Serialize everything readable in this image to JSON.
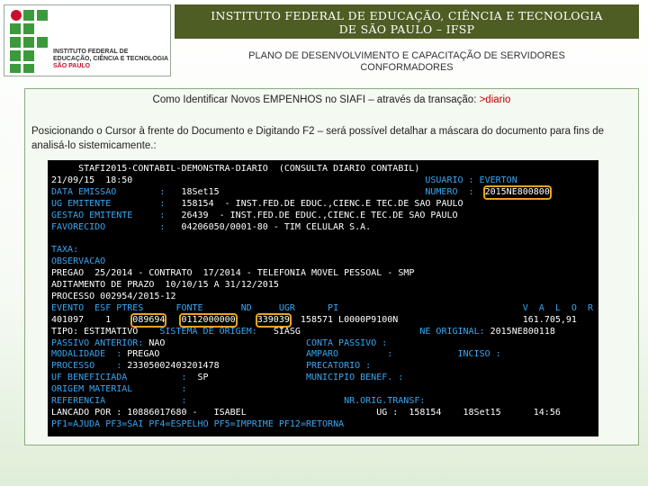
{
  "logo": {
    "line1": "INSTITUTO FEDERAL DE",
    "line2": "EDUCAÇÃO, CIÊNCIA E TECNOLOGIA",
    "line3": "SÃO PAULO"
  },
  "header": {
    "line1": "INSTITUTO FEDERAL DE EDUCAÇÃO, CIÊNCIA E TECNOLOGIA",
    "line2": "DE SÃO PAULO – IFSP"
  },
  "subtitle": {
    "line1": "PLANO DE DESENVOLVIMENTO E CAPACITAÇÃO DE SERVIDORES",
    "line2": "CONFORMADORES"
  },
  "content": {
    "title_prefix": "Como Identificar Novos EMPENHOS no SIAFI – através da transação: ",
    "title_highlight": ">diario",
    "paragraph": "Posicionando o Cursor à frente do Documento e Digitando F2 – será possível detalhar a máscara do documento para fins de analisá-lo sistemicamente.:"
  },
  "colors": {
    "header_bg": "#4e5d23",
    "terminal_cyan": "#3aa6f2",
    "terminal_white": "#ffffff",
    "highlight_box": "#f0a020",
    "highlight_text": "#c00000"
  },
  "terminal": {
    "rows": [
      [
        "     STAFI2015-CONTABIL-DEMONSTRA-DIARIO  (CONSULTA DIARIO CONTABIL)"
      ],
      [
        "21/09/15  18:50",
        "USUARIO : EVERTON"
      ],
      [
        "DATA EMISSAO",
        ":",
        "18Set15",
        "NUMERO  :",
        "2015NE800800"
      ],
      [
        "UG EMITENTE",
        ":",
        "158154  - INST.FED.DE EDUC.,CIENC.E TEC.DE SAO PAULO"
      ],
      [
        "GESTAO EMITENTE",
        ":",
        "26439  - INST.FED.DE EDUC.,CIENC.E TEC.DE SAO PAULO"
      ],
      [
        "FAVORECIDO",
        ":",
        "04206050/0001-80 - TIM CELULAR S.A."
      ],
      [
        ""
      ],
      [
        "TAXA:"
      ],
      [
        "OBSERVACAO"
      ],
      [
        "PREGAO  25/2014 - CONTRATO  17/2014 - TELEFONIA MOVEL PESSOAL - SMP"
      ],
      [
        "ADITAMENTO DE PRAZO  10/10/15 A 31/12/2015"
      ],
      [
        "PROCESSO 002954/2015-12"
      ],
      [
        "EVENTO  ESF PTRES      FONTE       ND     UGR      PI",
        "V  A  L  O  R"
      ],
      [
        "401097    1",
        "089694",
        "0112000000",
        "339039",
        "158571 L0000P9100N",
        "161.705,91"
      ],
      [
        "TIPO: ESTIMATIVO",
        "SISTEMA DE ORIGEM:",
        "SIASG",
        "NE ORIGINAL:",
        "2015NE800118"
      ],
      [
        "PASSIVO ANTERIOR:",
        "NAO",
        "CONTA PASSIVO :"
      ],
      [
        "MODALIDADE",
        ":",
        "PREGAO",
        "AMPARO",
        ":",
        "INCISO :"
      ],
      [
        "PROCESSO",
        ":",
        "23305002403201478",
        "PRECATORIO :"
      ],
      [
        "UF BENEFICIADA",
        ":",
        "SP",
        "MUNICIPIO BENEF. :"
      ],
      [
        "ORIGEM MATERIAL",
        ":"
      ],
      [
        "REFERENCIA",
        ":",
        "NR.ORIG.TRANSF:"
      ],
      [
        "LANCADO POR :",
        "10886017680 -   ISABEL",
        "UG :",
        "158154",
        "18Set15",
        "14:56"
      ],
      [
        "PF1=AJUDA PF3=SAI PF4=ESPELHO PF5=IMPRIME PF12=RETORNA"
      ]
    ]
  }
}
